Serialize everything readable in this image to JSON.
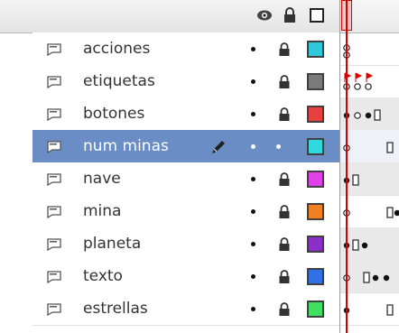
{
  "header": {
    "eye_icon": "eye-icon",
    "lock_icon": "lock-icon",
    "outline_icon": "outline-square-icon"
  },
  "layers": [
    {
      "name": "acciones",
      "color": "#30c8d8",
      "visible": true,
      "locked": true
    },
    {
      "name": "etiquetas",
      "color": "#7a7a7a",
      "visible": true,
      "locked": true
    },
    {
      "name": "botones",
      "color": "#e84040",
      "visible": true,
      "locked": true
    },
    {
      "name": "num minas",
      "color": "#30d8e0",
      "visible": true,
      "locked": false,
      "selected": true
    },
    {
      "name": "nave",
      "color": "#e040e8",
      "visible": true,
      "locked": true
    },
    {
      "name": "mina",
      "color": "#f08020",
      "visible": true,
      "locked": true
    },
    {
      "name": "planeta",
      "color": "#8a30c8",
      "visible": true,
      "locked": true
    },
    {
      "name": "texto",
      "color": "#3070e8",
      "visible": true,
      "locked": true
    },
    {
      "name": "estrellas",
      "color": "#40e060",
      "visible": true,
      "locked": true
    }
  ]
}
